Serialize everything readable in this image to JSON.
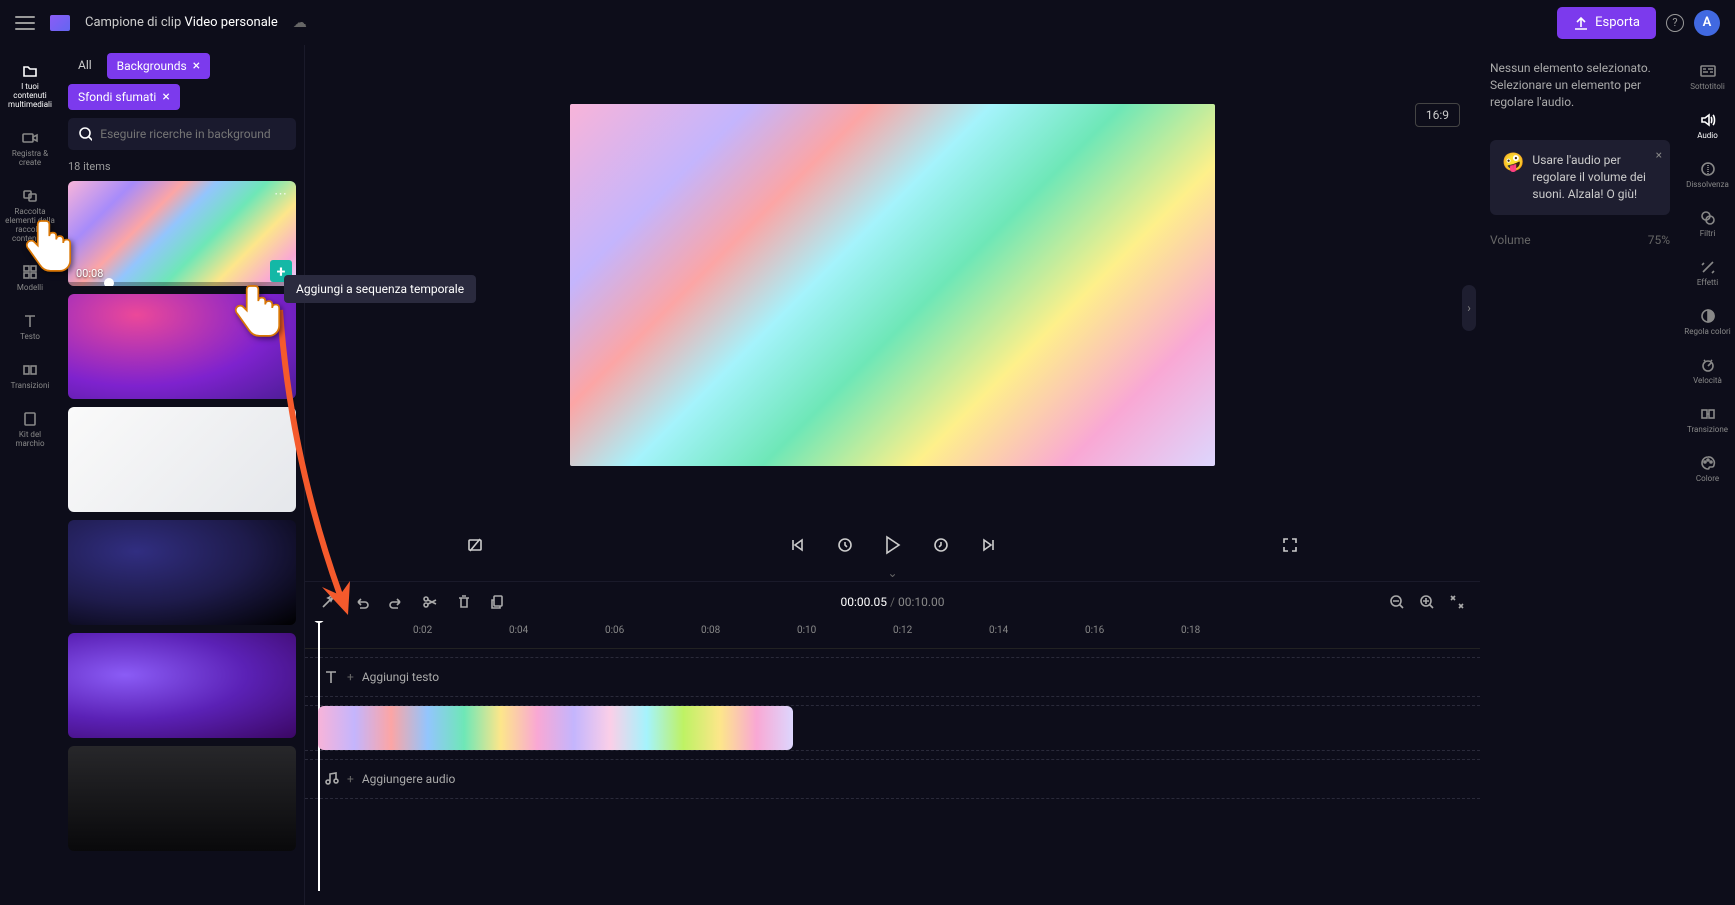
{
  "header": {
    "title_prefix": "Campione di clip",
    "title_suffix": "Video personale",
    "export_label": "Esporta",
    "avatar_letter": "A"
  },
  "nav_rail": [
    {
      "id": "media",
      "label": "I tuoi contenuti multimediali"
    },
    {
      "id": "record",
      "label": "Registra &amp; create"
    },
    {
      "id": "library",
      "label": "Raccolta elementi della raccolta contenuto"
    },
    {
      "id": "templates",
      "label": "Modelli"
    },
    {
      "id": "text",
      "label": "Testo"
    },
    {
      "id": "transitions",
      "label": "Transizioni"
    },
    {
      "id": "brand",
      "label": "Kit del marchio"
    }
  ],
  "content": {
    "chip_all": "All",
    "chip_backgrounds": "Backgrounds",
    "chip_gradients": "Sfondi sfumati",
    "search_placeholder": "Eseguire ricerche in background",
    "items_count": "18",
    "items_label": "items",
    "asset_duration": "00:08"
  },
  "tooltip": "Aggiungi a sequenza temporale",
  "preview": {
    "aspect": "16:9"
  },
  "timeline": {
    "current": "00:00.05",
    "total": "00:10.00",
    "ticks": [
      "0:02",
      "0:04",
      "0:06",
      "0:08",
      "0:10",
      "0:12",
      "0:14",
      "0:16",
      "0:18"
    ],
    "add_text": "Aggiungi testo",
    "add_audio": "Aggiungere audio"
  },
  "props": {
    "no_selection": "Nessun elemento selezionato. Selezionare un elemento per regolare l'audio.",
    "tip": "Usare l'audio per regolare il volume dei suoni. Alzala! O giù!",
    "volume_label": "Volume",
    "volume_value": "75%"
  },
  "side_rail": [
    {
      "id": "subtitles",
      "label": "Sottotitoli"
    },
    {
      "id": "audio",
      "label": "Audio"
    },
    {
      "id": "fade",
      "label": "Dissolvenza"
    },
    {
      "id": "filters",
      "label": "Filtri"
    },
    {
      "id": "effects",
      "label": "Effetti"
    },
    {
      "id": "adjust",
      "label": "Regola colori"
    },
    {
      "id": "speed",
      "label": "Velocità"
    },
    {
      "id": "transition",
      "label": "Transizione"
    },
    {
      "id": "color",
      "label": "Colore"
    }
  ]
}
